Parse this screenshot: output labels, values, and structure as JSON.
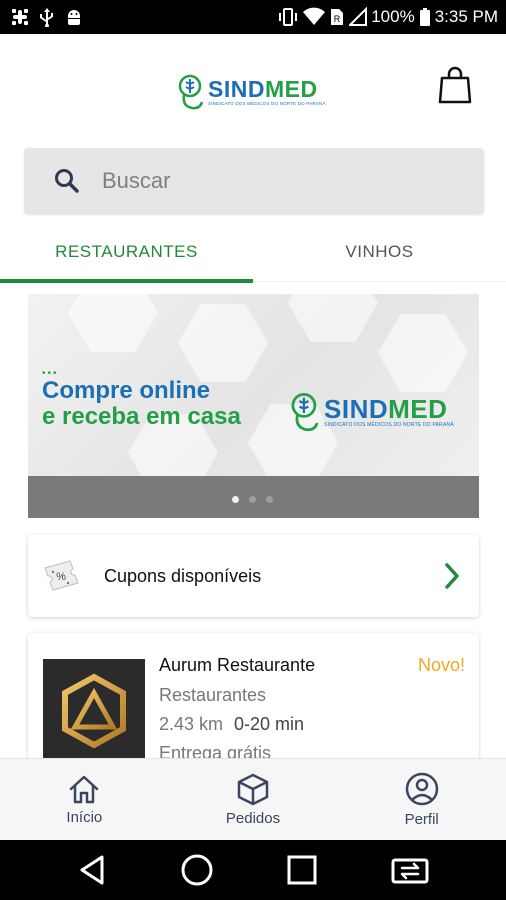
{
  "status_bar": {
    "battery": "100%",
    "time": "3:35 PM",
    "icons_left": [
      "slack-icon",
      "usb-icon",
      "android-debug-icon"
    ],
    "icons_right": [
      "vibrate-icon",
      "wifi-icon",
      "sim-icon",
      "signal-icon",
      "battery-icon"
    ]
  },
  "header": {
    "logo_name_part1": "SIND",
    "logo_name_part2": "MED",
    "logo_subtitle": "SINDICATO DOS MÉDICOS DO NORTE DO PARANÁ",
    "cart_icon": "shopping-bag-icon"
  },
  "search": {
    "placeholder": "Buscar",
    "icon": "search-icon"
  },
  "tabs": [
    {
      "label": "RESTAURANTES",
      "active": true
    },
    {
      "label": "VINHOS",
      "active": false
    }
  ],
  "banner": {
    "headline_line1": "Compre online",
    "headline_line2": "e receba em casa",
    "logo_name_part1": "SIND",
    "logo_name_part2": "MED",
    "logo_subtitle": "SINDICATO DOS MÉDICOS DO NORTE DO PARANÁ",
    "slide_count": 3,
    "active_slide": 1
  },
  "coupons": {
    "label": "Cupons disponíveis",
    "icon": "coupon-icon"
  },
  "restaurant": {
    "name": "Aurum Restaurante",
    "badge": "Novo!",
    "category": "Restaurantes",
    "distance": "2.43 km",
    "time": "0-20 min",
    "delivery": "Entrega grátis"
  },
  "bottom_nav": [
    {
      "label": "Início",
      "icon": "home-icon"
    },
    {
      "label": "Pedidos",
      "icon": "box-icon"
    },
    {
      "label": "Perfil",
      "icon": "profile-icon"
    }
  ],
  "colors": {
    "brand_blue": "#1a6fb5",
    "brand_green": "#23a047",
    "tab_active": "#1e8a3a",
    "badge": "#f4a81c"
  }
}
